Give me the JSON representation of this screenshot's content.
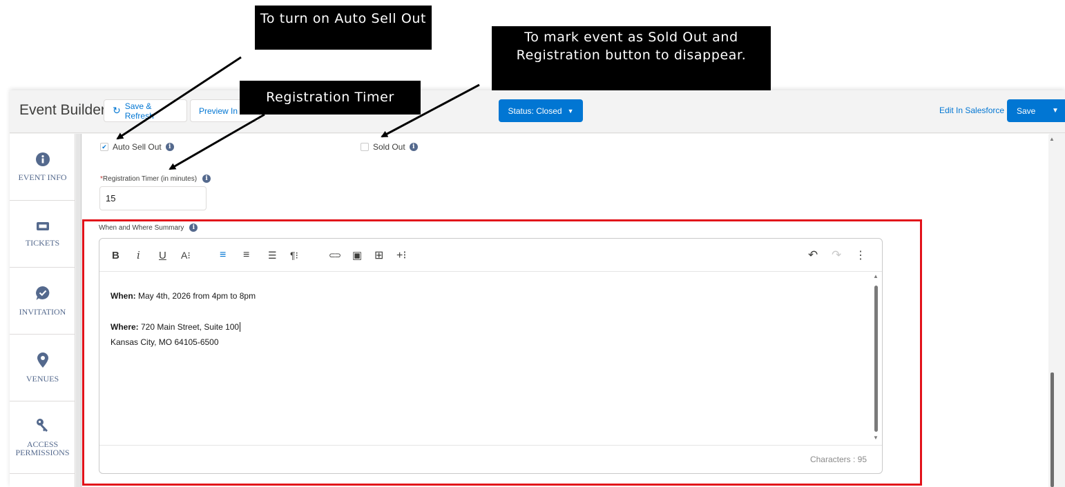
{
  "annotations": {
    "auto_sell_out_callout": "To turn on Auto Sell Out",
    "sold_out_callout": "To mark event as Sold Out and Registration button to disappear.",
    "timer_callout": "Registration Timer"
  },
  "header": {
    "title": "Event Builder",
    "save_refresh": "Save & Refresh",
    "preview": "Preview In",
    "status": "Status: Closed",
    "edit_in_salesforce": "Edit In Salesforce",
    "save": "Save"
  },
  "sidebar": {
    "items": [
      {
        "label": "EVENT INFO",
        "icon": "info-icon"
      },
      {
        "label": "TICKETS",
        "icon": "ticket-icon"
      },
      {
        "label": "INVITATION",
        "icon": "chat-check-icon"
      },
      {
        "label": "VENUES",
        "icon": "location-pin-icon"
      },
      {
        "label": "ACCESS PERMISSIONS",
        "icon": "key-icon"
      }
    ]
  },
  "form": {
    "auto_sell_out": {
      "label": "Auto Sell Out",
      "checked": true
    },
    "sold_out": {
      "label": "Sold Out",
      "checked": false
    },
    "registration_timer": {
      "required_mark": "*",
      "label": "Registration Timer (in minutes)",
      "value": "15"
    },
    "summary": {
      "label": "When and Where Summary",
      "when_label": "When:",
      "when_value": " May 4th, 2026 from 4pm to 8pm",
      "where_label": "Where:",
      "where_value": " 720 Main Street, Suite 100",
      "where_line2": "Kansas City, MO 64105-6500",
      "character_count": "Characters : 95"
    }
  },
  "toolbar": {
    "bold": "B",
    "italic": "i",
    "underline": "U",
    "font_size": "A⁝",
    "align_left": "≡",
    "align_center": "≡",
    "list": "☰",
    "paragraph": "¶⁝",
    "link": "⊂⊃",
    "image": "▣",
    "table": "⊞",
    "insert_more": "+⁝",
    "undo": "↶",
    "redo": "↷",
    "more": "⋮"
  },
  "colors": {
    "brand": "#0176d3",
    "highlight": "#e2121a",
    "callout_bg": "#000000"
  }
}
